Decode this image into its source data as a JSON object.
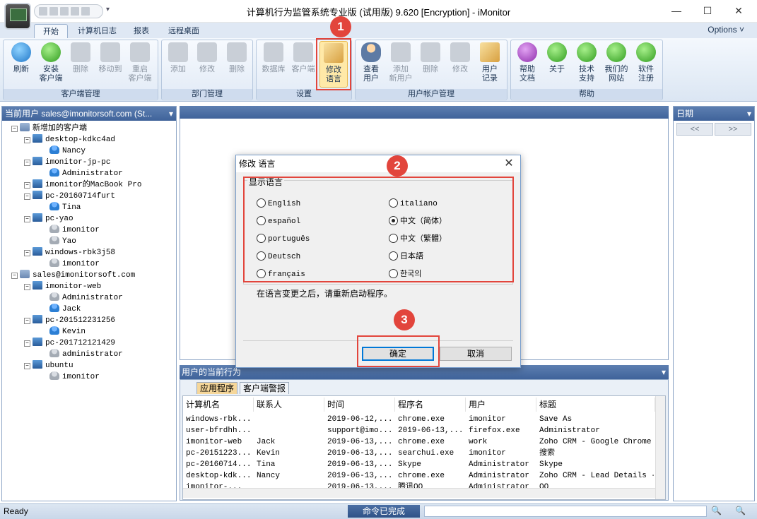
{
  "window": {
    "title": "计算机行为监管系统专业版 (试用版) 9.620 [Encryption] - iMonitor",
    "controls": {
      "minimize": "—",
      "maximize": "☐",
      "close": "✕"
    }
  },
  "ribbon": {
    "tabs": [
      "开始",
      "计算机日志",
      "报表",
      "远程桌面"
    ],
    "active_tab": "开始",
    "options_label": "Options ˅",
    "groups": {
      "client_mgmt": {
        "label": "客户端管理",
        "buttons": [
          "刷新",
          "安装\n客户端",
          "删除",
          "移动到",
          "重启\n客户端"
        ]
      },
      "dept_mgmt": {
        "label": "部门管理",
        "buttons": [
          "添加",
          "修改",
          "删除"
        ]
      },
      "settings": {
        "label": "设置",
        "buttons": [
          "数据库",
          "客户端",
          "修改\n语言"
        ]
      },
      "user_accounts": {
        "label": "用户帐户管理",
        "buttons": [
          "查看\n用户",
          "添加\n新用户",
          "删除",
          "修改",
          "用户\n记录"
        ]
      },
      "help": {
        "label": "帮助",
        "buttons": [
          "帮助\n文档",
          "关于",
          "技术\n支持",
          "我们的\n网站",
          "软件\n注册"
        ]
      }
    }
  },
  "badges": [
    "1",
    "2",
    "3"
  ],
  "left_panel": {
    "title": "当前用户 sales@imonitorsoft.com (St...",
    "tree": [
      {
        "label": "新增加的客户端",
        "level": 0,
        "icon": "network-icon"
      },
      {
        "label": "desktop-kdkc4ad",
        "level": 1,
        "icon": "computer-icon"
      },
      {
        "label": "Nancy",
        "level": 2,
        "icon": "user-icon"
      },
      {
        "label": "imonitor-jp-pc",
        "level": 1,
        "icon": "computer-icon"
      },
      {
        "label": "Administrator",
        "level": 2,
        "icon": "user-icon"
      },
      {
        "label": "imonitor的MacBook Pro",
        "level": 1,
        "icon": "computer-icon"
      },
      {
        "label": "pc-20160714furt",
        "level": 1,
        "icon": "computer-icon"
      },
      {
        "label": "Tina",
        "level": 2,
        "icon": "user-icon"
      },
      {
        "label": "pc-yao",
        "level": 1,
        "icon": "computer-icon"
      },
      {
        "label": "imonitor",
        "level": 2,
        "icon": "user-grey-icon"
      },
      {
        "label": "Yao",
        "level": 2,
        "icon": "user-grey-icon"
      },
      {
        "label": "windows-rbk3j58",
        "level": 1,
        "icon": "computer-icon"
      },
      {
        "label": "imonitor",
        "level": 2,
        "icon": "user-grey-icon"
      },
      {
        "label": "sales@imonitorsoft.com",
        "level": 0,
        "icon": "network-icon"
      },
      {
        "label": "imonitor-web",
        "level": 1,
        "icon": "computer-icon"
      },
      {
        "label": "Administrator",
        "level": 2,
        "icon": "user-grey-icon"
      },
      {
        "label": "Jack",
        "level": 2,
        "icon": "user-icon"
      },
      {
        "label": "pc-201512231256",
        "level": 1,
        "icon": "computer-icon"
      },
      {
        "label": "Kevin",
        "level": 2,
        "icon": "user-icon"
      },
      {
        "label": "pc-201712121429",
        "level": 1,
        "icon": "computer-icon"
      },
      {
        "label": "administrator",
        "level": 2,
        "icon": "user-grey-icon"
      },
      {
        "label": "ubuntu",
        "level": 1,
        "icon": "computer-icon"
      },
      {
        "label": "imonitor",
        "level": 2,
        "icon": "user-grey-icon"
      }
    ]
  },
  "right_panel": {
    "title": "日期",
    "prev": "<<",
    "next": ">>"
  },
  "bottom_panel": {
    "title": "用户的当前行为",
    "tabs": [
      "应用程序",
      "客户端警报"
    ],
    "columns": [
      "计算机名",
      "联系人",
      "时间",
      "程序名",
      "用户",
      "标题"
    ],
    "rows": [
      [
        "windows-rbk...",
        "",
        "2019-06-12,...",
        "chrome.exe",
        "imonitor",
        "Save As"
      ],
      [
        "user-bfrdhh...",
        "",
        "support@imo...",
        "2019-06-13,...",
        "firefox.exe",
        "Administrator"
      ],
      [
        "imonitor-web",
        "Jack",
        "2019-06-13,...",
        "chrome.exe",
        "work",
        "Zoho CRM - Google Chrome"
      ],
      [
        "pc-20151223...",
        "Kevin",
        "2019-06-13,...",
        "searchui.exe",
        "imonitor",
        "搜索"
      ],
      [
        "pc-20160714...",
        "Tina",
        "2019-06-13,...",
        "Skype",
        "Administrator",
        "Skype"
      ],
      [
        "desktop-kdk...",
        "Nancy",
        "2019-06-13,...",
        "chrome.exe",
        "Administrator",
        "Zoho CRM - Lead Details - G"
      ],
      [
        "imonitor-...",
        "",
        "2019-06-13,...",
        "腾讯QQ",
        "Administrator",
        "QQ"
      ]
    ]
  },
  "status_bar": {
    "left": "Ready",
    "center": "命令已完成"
  },
  "dialog": {
    "title": "修改 语言",
    "close": "✕",
    "group_label": "显示语言",
    "options_left": [
      "English",
      "español",
      "português",
      "Deutsch",
      "français"
    ],
    "options_right": [
      "italiano",
      "中文（简体）",
      "中文（繁體）",
      "日本語",
      "한국의"
    ],
    "selected": "中文（简体）",
    "note": "在语言变更之后，请重新启动程序。",
    "ok": "确定",
    "cancel": "取消"
  },
  "colors": {
    "accent_red": "#e2453c",
    "panel_header": "#4a6ea4",
    "ribbon_bg": "#dfe8f4"
  }
}
